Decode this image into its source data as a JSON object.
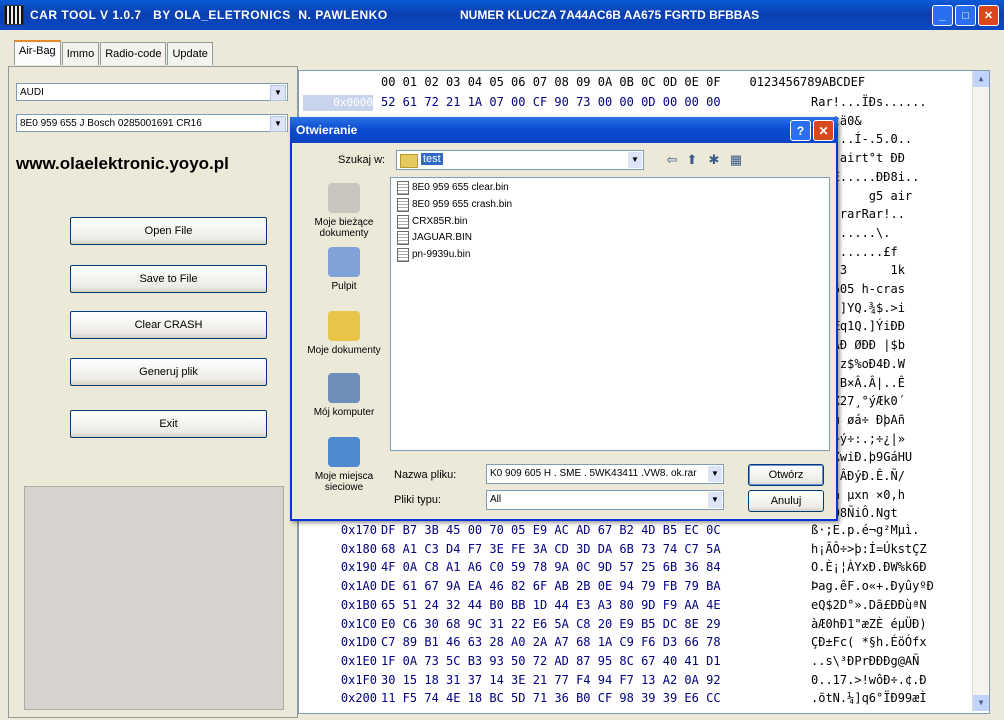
{
  "window": {
    "title": "CAR TOOL V 1.0.7   BY OLA_ELETRONICS  N. PAWLENKO",
    "key_title": "NUMER KLUCZA 7A44AC6B AA675 FGRTD BFBBAS",
    "minimize": "_",
    "maximize": "□",
    "close": "✕"
  },
  "tabs": [
    "Air-Bag",
    "Immo",
    "Radio-code",
    "Update"
  ],
  "left_panel": {
    "make_select": "AUDI",
    "module_select": "8E0 959 655 J Bosch 0285001691 CR16",
    "site_link": "www.olaelektronic.yoyo.pl",
    "buttons": {
      "open": "Open File",
      "save": "Save to File",
      "clear": "Clear CRASH",
      "generate": "Generuj plik",
      "exit": "Exit"
    }
  },
  "hex": {
    "header": "00 01 02 03 04 05 06 07 08 09 0A 0B 0C 0D 0E 0F",
    "ascii_header": "0123456789ABCDEF",
    "first_offset": "0x0000",
    "rows_top": [
      {
        "bytes": "52 61 72 21 1A 07 00 CF 90 73 00 00 0D 00 00 00",
        "ascii": "Rar!...ÏÐs......"
      },
      {
        "bytes": "",
        "ascii": "..-tä0&"
      },
      {
        "bytes": "",
        "ascii": "......Í-.5.0.."
      },
      {
        "bytes": "",
        "ascii": ".g5 airt°t ÐÐ"
      },
      {
        "bytes": "",
        "ascii": "...Ê.....ÐÐ8i.."
      },
      {
        "bytes": "",
        "ascii": "0       g5 air"
      },
      {
        "bytes": "",
        "ascii": "524.rarRar!.."
      },
      {
        "bytes": "",
        "ascii": ".........\\."
      },
      {
        "bytes": "",
        "ascii": "8.w.......£f"
      },
      {
        "bytes": "",
        "ascii": "Ð 3 3      1k"
      },
      {
        "bytes": "",
        "ascii": "09 605 h-cras"
      },
      {
        "bytes": "",
        "ascii": "bin.]YQ.¾$.>i"
      },
      {
        "bytes": "",
        "ascii": "sL]Æq1Q.]ÝiÐÐ"
      },
      {
        "bytes": "",
        "ascii": "Ò`ÒÅÐ ØÐÐ |$b"
      },
      {
        "bytes": "",
        "ascii": "`V0]z$%oÐ4Ð.W"
      },
      {
        "bytes": "",
        "ascii": "Ð.B`B×Â.Â|..Ê"
      },
      {
        "bytes": "",
        "ascii": "ýÐ<X27¸°ýÆk0´"
      },
      {
        "bytes": "",
        "ascii": "å~.ü øá÷ ÐþAñ"
      },
      {
        "bytes": "",
        "ascii": "Äu|~ý÷:.;÷¿|»"
      },
      {
        "bytes": "",
        "ascii": "W.ÑXwiÐ.þ9GáHU"
      },
      {
        "bytes": "",
        "ascii": ".\"J,ÂÐýÐ.Ê.Ñ/"
      },
      {
        "bytes": "",
        "ascii": "°- å µxn ×0,h"
      },
      {
        "bytes": "",
        "ascii": "..þÒ8ÑiÔ.Ngt"
      }
    ],
    "rows": [
      {
        "off": "0x170",
        "bytes": "DF B7 3B 45 00 70 05 E9 AC AD 67 B2 4D B5 EC 0C",
        "ascii": "ß·;E.p.é¬­g²Mµì."
      },
      {
        "off": "0x180",
        "bytes": "68 A1 C3 D4 F7 3E FE 3A CD 3D DA 6B 73 74 C7 5A",
        "ascii": "h¡ÃÔ÷>þ:Í=ÚkstÇZ"
      },
      {
        "off": "0x190",
        "bytes": "4F 0A C8 A1 A6 C0 59 78 9A 0C 9D 57 25 6B 36 84",
        "ascii": "O.È¡¦ÀYxÐ.ÐW%k6Ð"
      },
      {
        "off": "0x1A0",
        "bytes": "DE 61 67 9A EA 46 82 6F AB 2B 0E 94 79 FB 79 BA",
        "ascii": "Þag.êF.o«+.ÐyûyºÐ"
      },
      {
        "off": "0x1B0",
        "bytes": "65 51 24 32 44 B0 BB 1D 44 E3 A3 80 9D F9 AA 4E",
        "ascii": "eQ$2D°».Dã£ÐÐùªN"
      },
      {
        "off": "0x1C0",
        "bytes": "E0 C6 30 68 9C 31 22 E6 5A C8 20 E9 B5 DC 8E 29",
        "ascii": "àÆ0hÐ1\"æZÈ éµÜÐ)"
      },
      {
        "off": "0x1D0",
        "bytes": "C7 89 B1 46 63 28 A0 2A A7 68 1A C9 F6 D3 66 78",
        "ascii": "ÇÐ±Fc( *§h.ÉöÓfx"
      },
      {
        "off": "0x1E0",
        "bytes": "1F 0A 73 5C B3 93 50 72 AD 87 95 8C 67 40 41 D1",
        "ascii": "..s\\³ÐPr­ÐÐÐg@AÑ"
      },
      {
        "off": "0x1F0",
        "bytes": "30 15 18 31 37 14 3E 21 77 F4 94 F7 13 A2 0A 92",
        "ascii": "0..17.>!wôÐ÷.¢.Ð"
      },
      {
        "off": "0x200",
        "bytes": "11 F5 74 4E 18 BC 5D 71 36 B0 CF 98 39 39 E6 CC",
        "ascii": ".õtN.¼]q6°ÏÐ99æÌ"
      }
    ]
  },
  "dialog": {
    "title": "Otwieranie",
    "help": "?",
    "close": "✕",
    "look_in_label": "Szukaj w:",
    "look_in_value": "test",
    "places": [
      {
        "label": "Moje bieżące dokumenty",
        "icon": "recent-documents-icon"
      },
      {
        "label": "Pulpit",
        "icon": "desktop-icon"
      },
      {
        "label": "Moje dokumenty",
        "icon": "my-documents-icon"
      },
      {
        "label": "Mój komputer",
        "icon": "my-computer-icon"
      },
      {
        "label": "Moje miejsca sieciowe",
        "icon": "network-places-icon"
      }
    ],
    "files": [
      "8E0 959 655 clear.bin",
      "8E0 959 655 crash.bin",
      "CRX85R.bin",
      "JAGUAR.BIN",
      "pn-9939u.bin"
    ],
    "filename_label": "Nazwa pliku:",
    "filename_value": "K0 909 605 H . SME . 5WK43411 .VW8. ok.rar",
    "filetype_label": "Pliki typu:",
    "filetype_value": "All",
    "open_button": "Otwórz",
    "cancel_button": "Anuluj"
  },
  "colors": {
    "titlebar": "#0a4ad0",
    "hex_bytes": "#000080",
    "close": "#d9481c"
  }
}
